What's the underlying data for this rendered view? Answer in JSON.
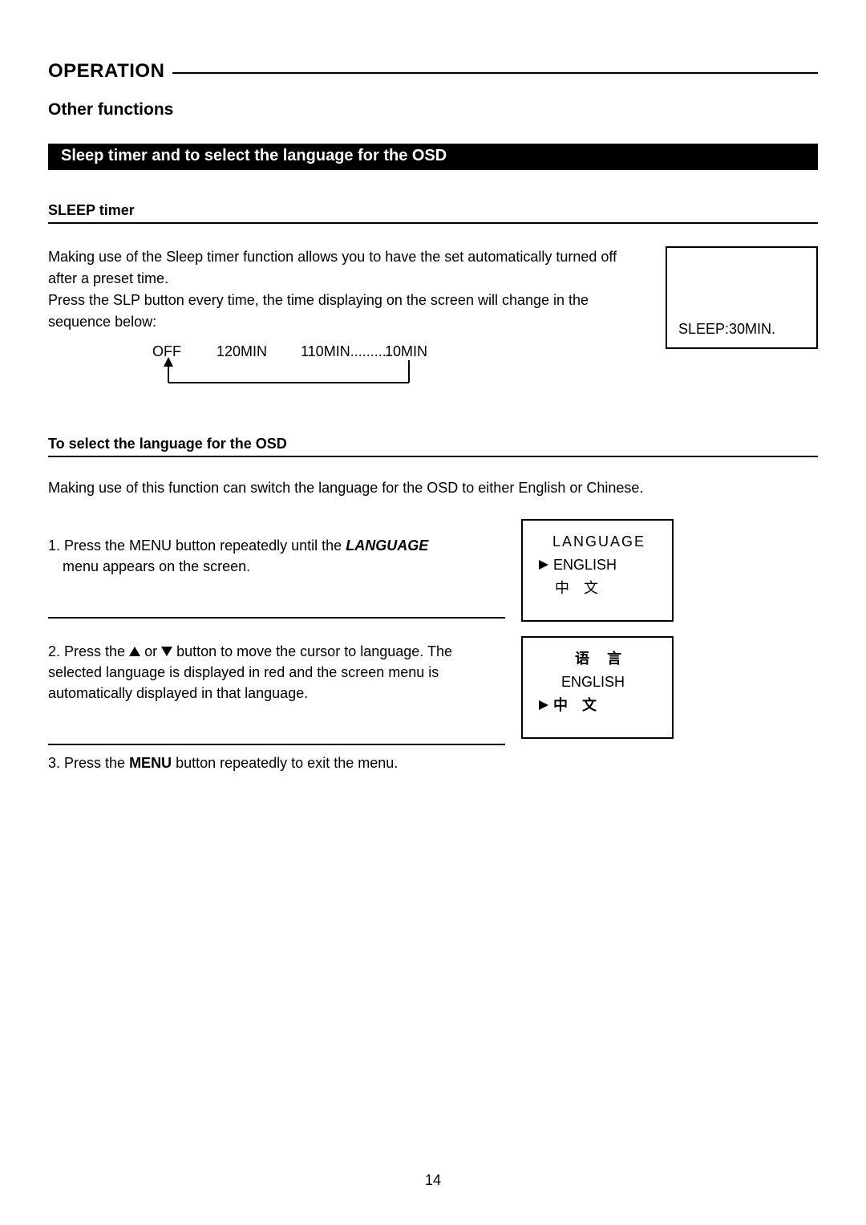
{
  "header": {
    "title": "OPERATION",
    "subtitle": "Other functions"
  },
  "blackBar": "Sleep timer and to select the language for the OSD",
  "sleep": {
    "heading": "SLEEP timer",
    "para1": "Making use of the Sleep timer function allows you to have the set automatically turned off after a preset time.",
    "para2": "Press the SLP button every time, the time displaying on the screen will change in the sequence below:",
    "seq": {
      "off": "OFF",
      "a": "120MIN",
      "b": "110MIN..........",
      "c": "10MIN"
    },
    "osd": "SLEEP:30MIN."
  },
  "lang": {
    "heading": "To select the language for the OSD",
    "intro": "Making use of this function can switch the language for the OSD to either English or Chinese.",
    "step1_prefix": "1. Press the MENU button repeatedly until the ",
    "step1_em": "LANGUAGE",
    "step1_suffix_line2": "menu appears on the screen.",
    "step2_prefix": "2. Press the ",
    "step2_mid": " or ",
    "step2_rest": " button to move the cursor  to language. The selected language is displayed in red and the screen menu is automatically displayed in that language.",
    "step3_prefix": "3. Press the ",
    "step3_bold": "MENU",
    "step3_suffix": " button repeatedly to exit the menu.",
    "box1": {
      "title": "LANGUAGE",
      "opt1": "ENGLISH",
      "opt2": "中　文"
    },
    "box2": {
      "title": "语　言",
      "opt1": "ENGLISH",
      "opt2": "中　文"
    }
  },
  "pageNumber": "14"
}
